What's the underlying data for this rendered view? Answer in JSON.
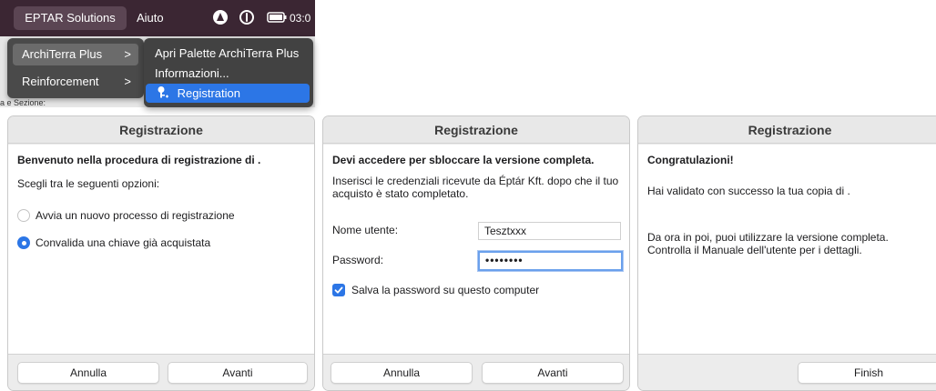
{
  "menubar": {
    "app_name": "EPTAR Solutions",
    "help": "Aiuto",
    "clock": "03:0",
    "tray_icons": [
      "avast-icon",
      "power-circle-icon",
      "battery-icon"
    ]
  },
  "menu_background_text": "a e Sezione:",
  "menu": {
    "items": [
      {
        "label": "ArchiTerra Plus",
        "chevron": ">"
      },
      {
        "label": "Reinforcement",
        "chevron": ">"
      }
    ]
  },
  "submenu": {
    "items": [
      {
        "label": "Apri Palette ArchiTerra Plus"
      },
      {
        "label": "Informazioni..."
      },
      {
        "label": "Registration",
        "icon": "key-icon"
      }
    ]
  },
  "dialog1": {
    "title": "Registrazione",
    "heading": "Benvenuto nella procedura di registrazione di .",
    "prompt": "Scegli tra le seguenti opzioni:",
    "options": [
      {
        "label": "Avvia un nuovo processo di registrazione",
        "selected": false
      },
      {
        "label": "Convalida una chiave già acquistata",
        "selected": true
      }
    ],
    "cancel_label": "Annulla",
    "next_label": "Avanti"
  },
  "dialog2": {
    "title": "Registrazione",
    "heading": "Devi accedere per sbloccare la versione completa.",
    "description": "Inserisci le credenziali ricevute da Éptár Kft. dopo che il tuo acquisto è stato completato.",
    "username_label": "Nome utente:",
    "username_value": "Tesztxxx",
    "password_label": "Password:",
    "password_value": "••••••••",
    "save_password_label": "Salva la password su questo computer",
    "save_password_checked": true,
    "cancel_label": "Annulla",
    "next_label": "Avanti"
  },
  "dialog3": {
    "title": "Registrazione",
    "heading": "Congratulazioni!",
    "message1": "Hai validato con successo la tua copia di .",
    "message2": "Da ora in poi, puoi utilizzare la versione completa. Controlla il Manuale dell'utente per i dettagli.",
    "finish_label": "Finish"
  },
  "colors": {
    "accent": "#2c76e6",
    "menubar": "#3b2633",
    "menu": "#424242"
  }
}
